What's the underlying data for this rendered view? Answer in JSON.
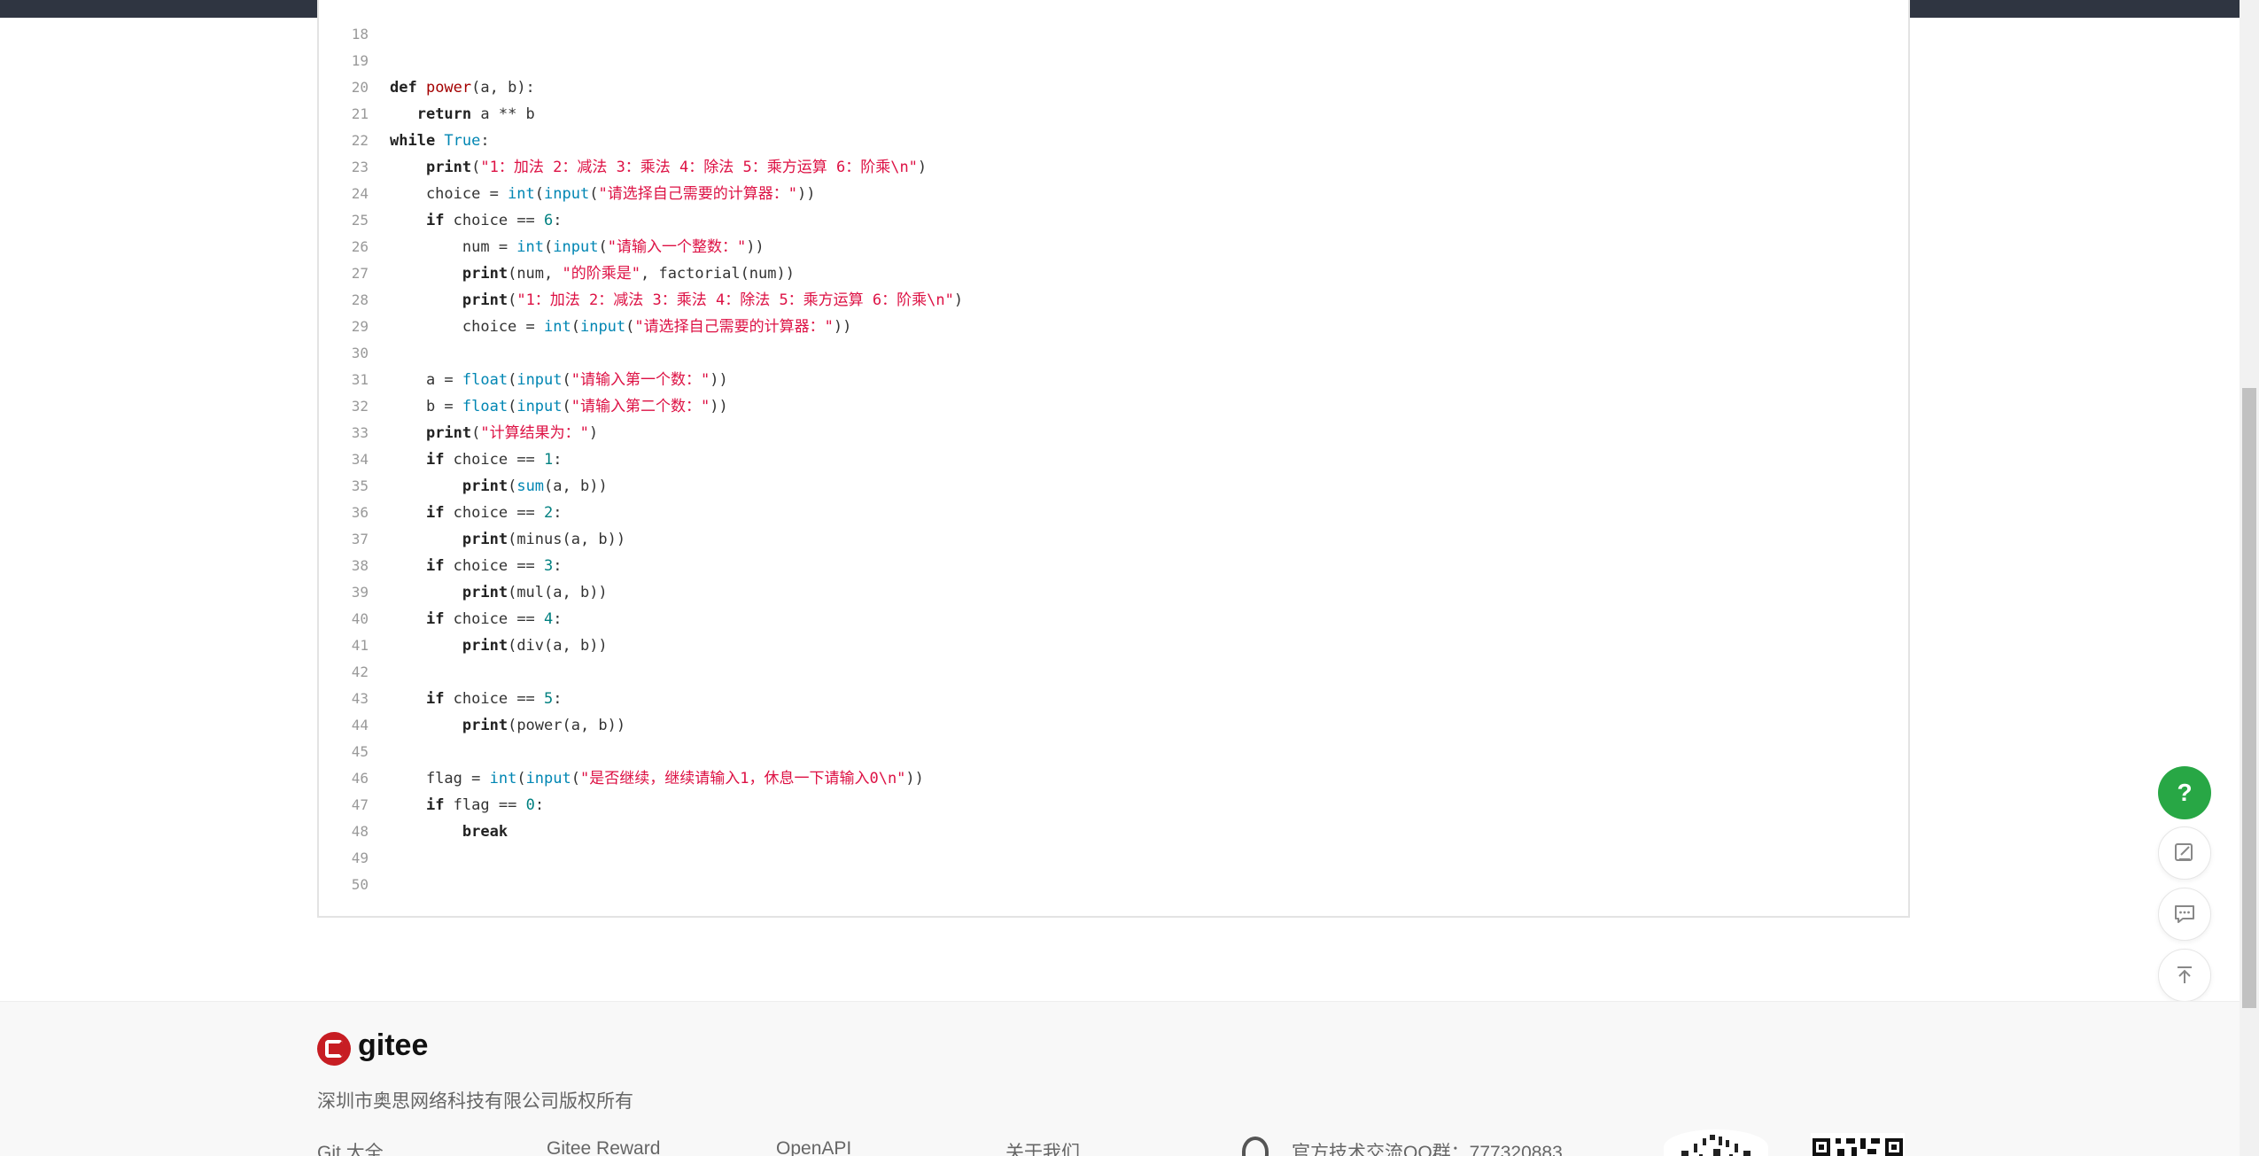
{
  "code": {
    "lines": [
      {
        "n": "18",
        "parts": []
      },
      {
        "n": "19",
        "parts": []
      },
      {
        "n": "20",
        "parts": [
          [
            "kw",
            "def "
          ],
          [
            "fn",
            "power"
          ],
          [
            "",
            "(a, b):"
          ]
        ]
      },
      {
        "n": "21",
        "parts": [
          [
            "",
            "   "
          ],
          [
            "kw",
            "return"
          ],
          [
            "",
            " a ** b"
          ]
        ]
      },
      {
        "n": "22",
        "parts": [
          [
            "kw",
            "while "
          ],
          [
            "bi",
            "True"
          ],
          [
            "",
            ":"
          ]
        ]
      },
      {
        "n": "23",
        "parts": [
          [
            "",
            "    "
          ],
          [
            "kw",
            "print"
          ],
          [
            "",
            "("
          ],
          [
            "st",
            "\"1：加法 2：减法 3：乘法 4：除法 5：乘方运算 6：阶乘\\n\""
          ],
          [
            "",
            ")"
          ]
        ]
      },
      {
        "n": "24",
        "parts": [
          [
            "",
            "    choice = "
          ],
          [
            "bi",
            "int"
          ],
          [
            "",
            "("
          ],
          [
            "bi",
            "input"
          ],
          [
            "",
            "("
          ],
          [
            "st",
            "\"请选择自己需要的计算器：\""
          ],
          [
            "",
            "))"
          ]
        ]
      },
      {
        "n": "25",
        "parts": [
          [
            "",
            "    "
          ],
          [
            "kw",
            "if"
          ],
          [
            "",
            " choice == "
          ],
          [
            "nu",
            "6"
          ],
          [
            "",
            ":"
          ]
        ]
      },
      {
        "n": "26",
        "parts": [
          [
            "",
            "        num = "
          ],
          [
            "bi",
            "int"
          ],
          [
            "",
            "("
          ],
          [
            "bi",
            "input"
          ],
          [
            "",
            "("
          ],
          [
            "st",
            "\"请输入一个整数：\""
          ],
          [
            "",
            "))"
          ]
        ]
      },
      {
        "n": "27",
        "parts": [
          [
            "",
            "        "
          ],
          [
            "kw",
            "print"
          ],
          [
            "",
            "(num, "
          ],
          [
            "st",
            "\"的阶乘是\""
          ],
          [
            "",
            ", factorial(num))"
          ]
        ]
      },
      {
        "n": "28",
        "parts": [
          [
            "",
            "        "
          ],
          [
            "kw",
            "print"
          ],
          [
            "",
            "("
          ],
          [
            "st",
            "\"1：加法 2：减法 3：乘法 4：除法 5：乘方运算 6：阶乘\\n\""
          ],
          [
            "",
            ")"
          ]
        ]
      },
      {
        "n": "29",
        "parts": [
          [
            "",
            "        choice = "
          ],
          [
            "bi",
            "int"
          ],
          [
            "",
            "("
          ],
          [
            "bi",
            "input"
          ],
          [
            "",
            "("
          ],
          [
            "st",
            "\"请选择自己需要的计算器：\""
          ],
          [
            "",
            "))"
          ]
        ]
      },
      {
        "n": "30",
        "parts": []
      },
      {
        "n": "31",
        "parts": [
          [
            "",
            "    a = "
          ],
          [
            "bi",
            "float"
          ],
          [
            "",
            "("
          ],
          [
            "bi",
            "input"
          ],
          [
            "",
            "("
          ],
          [
            "st",
            "\"请输入第一个数：\""
          ],
          [
            "",
            "))"
          ]
        ]
      },
      {
        "n": "32",
        "parts": [
          [
            "",
            "    b = "
          ],
          [
            "bi",
            "float"
          ],
          [
            "",
            "("
          ],
          [
            "bi",
            "input"
          ],
          [
            "",
            "("
          ],
          [
            "st",
            "\"请输入第二个数：\""
          ],
          [
            "",
            "))"
          ]
        ]
      },
      {
        "n": "33",
        "parts": [
          [
            "",
            "    "
          ],
          [
            "kw",
            "print"
          ],
          [
            "",
            "("
          ],
          [
            "st",
            "\"计算结果为：\""
          ],
          [
            "",
            ")"
          ]
        ]
      },
      {
        "n": "34",
        "parts": [
          [
            "",
            "    "
          ],
          [
            "kw",
            "if"
          ],
          [
            "",
            " choice == "
          ],
          [
            "nu",
            "1"
          ],
          [
            "",
            ":"
          ]
        ]
      },
      {
        "n": "35",
        "parts": [
          [
            "",
            "        "
          ],
          [
            "kw",
            "print"
          ],
          [
            "",
            "("
          ],
          [
            "bi",
            "sum"
          ],
          [
            "",
            "(a, b))"
          ]
        ]
      },
      {
        "n": "36",
        "parts": [
          [
            "",
            "    "
          ],
          [
            "kw",
            "if"
          ],
          [
            "",
            " choice == "
          ],
          [
            "nu",
            "2"
          ],
          [
            "",
            ":"
          ]
        ]
      },
      {
        "n": "37",
        "parts": [
          [
            "",
            "        "
          ],
          [
            "kw",
            "print"
          ],
          [
            "",
            "(minus(a, b))"
          ]
        ]
      },
      {
        "n": "38",
        "parts": [
          [
            "",
            "    "
          ],
          [
            "kw",
            "if"
          ],
          [
            "",
            " choice == "
          ],
          [
            "nu",
            "3"
          ],
          [
            "",
            ":"
          ]
        ]
      },
      {
        "n": "39",
        "parts": [
          [
            "",
            "        "
          ],
          [
            "kw",
            "print"
          ],
          [
            "",
            "(mul(a, b))"
          ]
        ]
      },
      {
        "n": "40",
        "parts": [
          [
            "",
            "    "
          ],
          [
            "kw",
            "if"
          ],
          [
            "",
            " choice == "
          ],
          [
            "nu",
            "4"
          ],
          [
            "",
            ":"
          ]
        ]
      },
      {
        "n": "41",
        "parts": [
          [
            "",
            "        "
          ],
          [
            "kw",
            "print"
          ],
          [
            "",
            "(div(a, b))"
          ]
        ]
      },
      {
        "n": "42",
        "parts": []
      },
      {
        "n": "43",
        "parts": [
          [
            "",
            "    "
          ],
          [
            "kw",
            "if"
          ],
          [
            "",
            " choice == "
          ],
          [
            "nu",
            "5"
          ],
          [
            "",
            ":"
          ]
        ]
      },
      {
        "n": "44",
        "parts": [
          [
            "",
            "        "
          ],
          [
            "kw",
            "print"
          ],
          [
            "",
            "(power(a, b))"
          ]
        ]
      },
      {
        "n": "45",
        "parts": []
      },
      {
        "n": "46",
        "parts": [
          [
            "",
            "    flag = "
          ],
          [
            "bi",
            "int"
          ],
          [
            "",
            "("
          ],
          [
            "bi",
            "input"
          ],
          [
            "",
            "("
          ],
          [
            "st",
            "\"是否继续，继续请输入1，休息一下请输入0\\n\""
          ],
          [
            "",
            "))"
          ]
        ]
      },
      {
        "n": "47",
        "parts": [
          [
            "",
            "    "
          ],
          [
            "kw",
            "if"
          ],
          [
            "",
            " flag == "
          ],
          [
            "nu",
            "0"
          ],
          [
            "",
            ":"
          ]
        ]
      },
      {
        "n": "48",
        "parts": [
          [
            "",
            "        "
          ],
          [
            "kw",
            "break"
          ]
        ]
      },
      {
        "n": "49",
        "parts": []
      },
      {
        "n": "50",
        "parts": []
      }
    ]
  },
  "fab": {
    "help_label": "?"
  },
  "footer": {
    "brand": "gitee",
    "copyright": "深圳市奥思网络科技有限公司版权所有",
    "links": [
      "Git 大全",
      "Gitee Reward",
      "OpenAPI",
      "关于我们"
    ],
    "qq_group": "官方技术交流QQ群：777320883"
  }
}
